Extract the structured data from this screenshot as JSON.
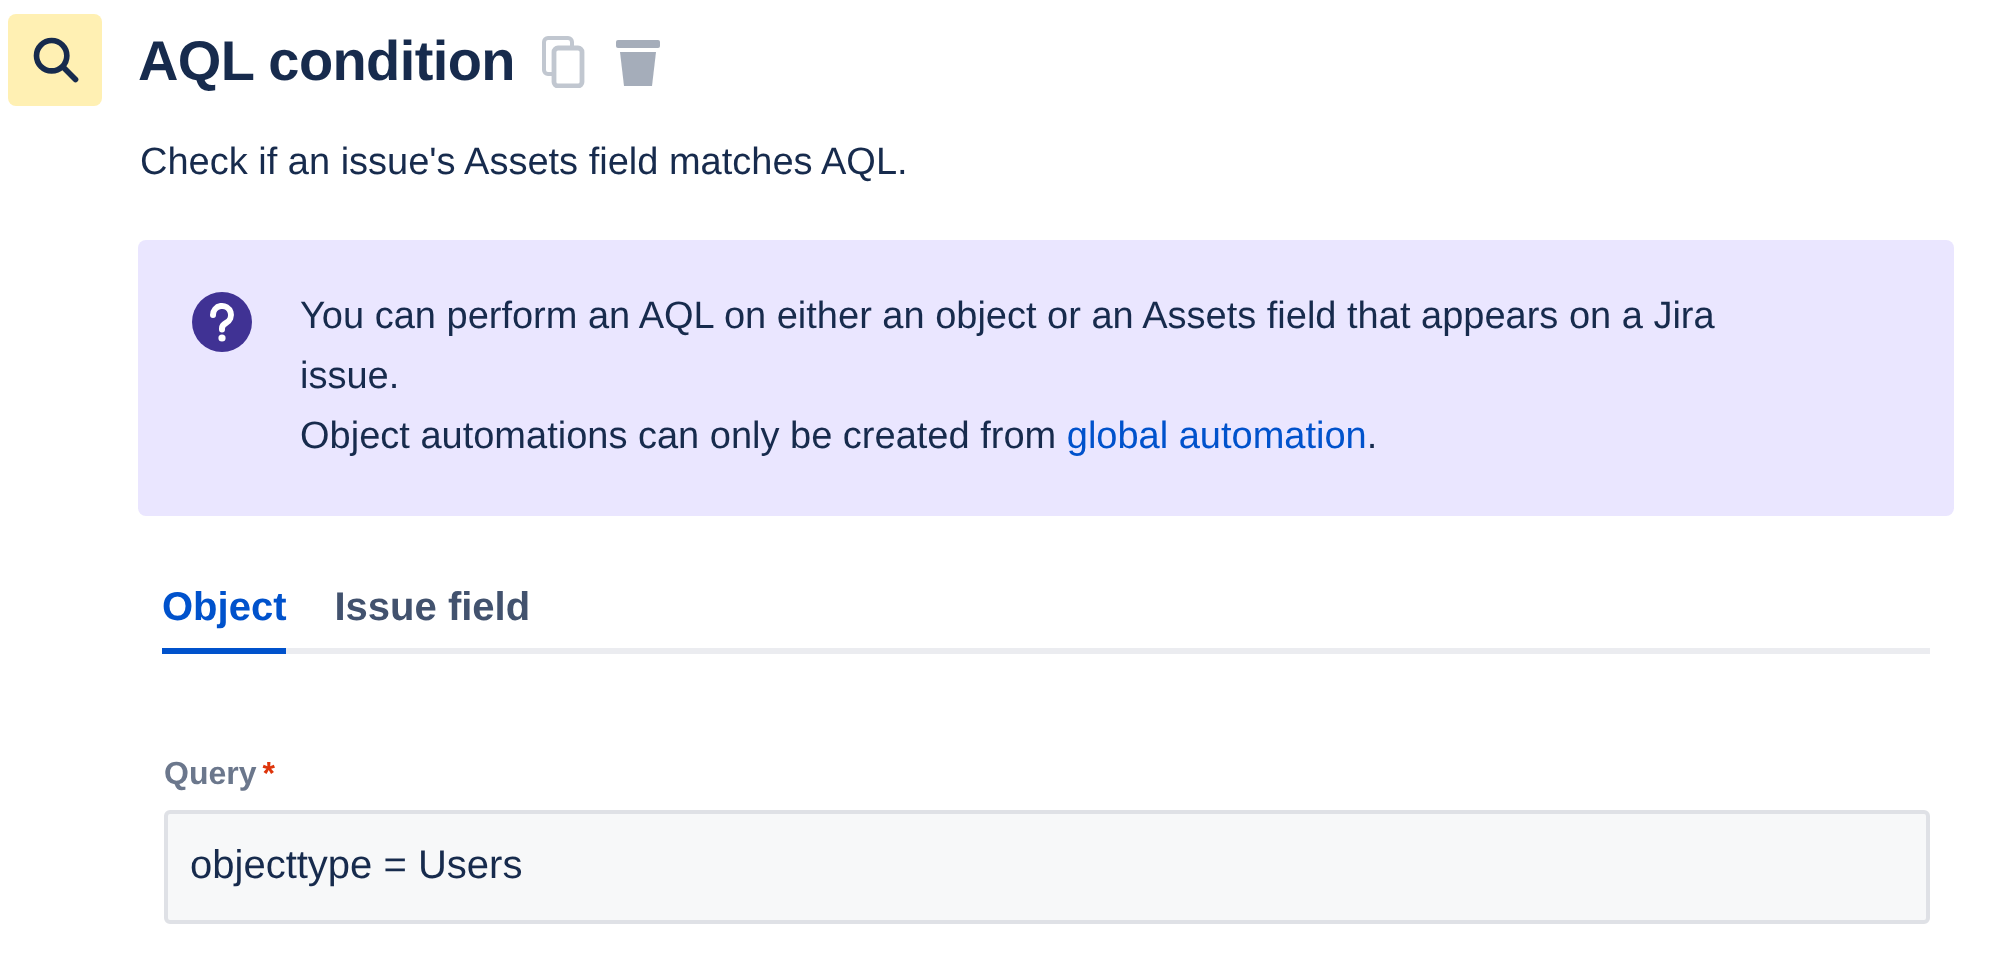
{
  "header": {
    "title": "AQL condition",
    "description": "Check if an issue's Assets field matches AQL."
  },
  "info": {
    "message": "You can perform an AQL on either an object or an Assets field that appears on a Jira issue.",
    "note": "Object automations can only be created from ",
    "link": "global automation",
    "note_end": "."
  },
  "tabs": [
    {
      "label": "Object",
      "selected": true
    },
    {
      "label": "Issue field",
      "selected": false
    }
  ],
  "query": {
    "label": "Query",
    "required_mark": "*",
    "value": "objecttype = Users"
  }
}
